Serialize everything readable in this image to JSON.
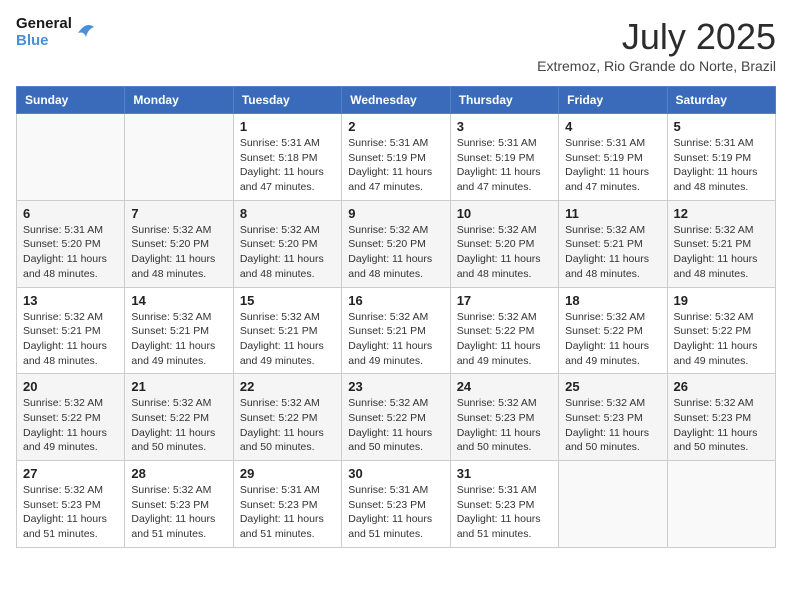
{
  "header": {
    "logo_line1": "General",
    "logo_line2": "Blue",
    "month": "July 2025",
    "location": "Extremoz, Rio Grande do Norte, Brazil"
  },
  "weekdays": [
    "Sunday",
    "Monday",
    "Tuesday",
    "Wednesday",
    "Thursday",
    "Friday",
    "Saturday"
  ],
  "weeks": [
    [
      {
        "day": "",
        "info": ""
      },
      {
        "day": "",
        "info": ""
      },
      {
        "day": "1",
        "info": "Sunrise: 5:31 AM\nSunset: 5:18 PM\nDaylight: 11 hours and 47 minutes."
      },
      {
        "day": "2",
        "info": "Sunrise: 5:31 AM\nSunset: 5:19 PM\nDaylight: 11 hours and 47 minutes."
      },
      {
        "day": "3",
        "info": "Sunrise: 5:31 AM\nSunset: 5:19 PM\nDaylight: 11 hours and 47 minutes."
      },
      {
        "day": "4",
        "info": "Sunrise: 5:31 AM\nSunset: 5:19 PM\nDaylight: 11 hours and 47 minutes."
      },
      {
        "day": "5",
        "info": "Sunrise: 5:31 AM\nSunset: 5:19 PM\nDaylight: 11 hours and 48 minutes."
      }
    ],
    [
      {
        "day": "6",
        "info": "Sunrise: 5:31 AM\nSunset: 5:20 PM\nDaylight: 11 hours and 48 minutes."
      },
      {
        "day": "7",
        "info": "Sunrise: 5:32 AM\nSunset: 5:20 PM\nDaylight: 11 hours and 48 minutes."
      },
      {
        "day": "8",
        "info": "Sunrise: 5:32 AM\nSunset: 5:20 PM\nDaylight: 11 hours and 48 minutes."
      },
      {
        "day": "9",
        "info": "Sunrise: 5:32 AM\nSunset: 5:20 PM\nDaylight: 11 hours and 48 minutes."
      },
      {
        "day": "10",
        "info": "Sunrise: 5:32 AM\nSunset: 5:20 PM\nDaylight: 11 hours and 48 minutes."
      },
      {
        "day": "11",
        "info": "Sunrise: 5:32 AM\nSunset: 5:21 PM\nDaylight: 11 hours and 48 minutes."
      },
      {
        "day": "12",
        "info": "Sunrise: 5:32 AM\nSunset: 5:21 PM\nDaylight: 11 hours and 48 minutes."
      }
    ],
    [
      {
        "day": "13",
        "info": "Sunrise: 5:32 AM\nSunset: 5:21 PM\nDaylight: 11 hours and 48 minutes."
      },
      {
        "day": "14",
        "info": "Sunrise: 5:32 AM\nSunset: 5:21 PM\nDaylight: 11 hours and 49 minutes."
      },
      {
        "day": "15",
        "info": "Sunrise: 5:32 AM\nSunset: 5:21 PM\nDaylight: 11 hours and 49 minutes."
      },
      {
        "day": "16",
        "info": "Sunrise: 5:32 AM\nSunset: 5:21 PM\nDaylight: 11 hours and 49 minutes."
      },
      {
        "day": "17",
        "info": "Sunrise: 5:32 AM\nSunset: 5:22 PM\nDaylight: 11 hours and 49 minutes."
      },
      {
        "day": "18",
        "info": "Sunrise: 5:32 AM\nSunset: 5:22 PM\nDaylight: 11 hours and 49 minutes."
      },
      {
        "day": "19",
        "info": "Sunrise: 5:32 AM\nSunset: 5:22 PM\nDaylight: 11 hours and 49 minutes."
      }
    ],
    [
      {
        "day": "20",
        "info": "Sunrise: 5:32 AM\nSunset: 5:22 PM\nDaylight: 11 hours and 49 minutes."
      },
      {
        "day": "21",
        "info": "Sunrise: 5:32 AM\nSunset: 5:22 PM\nDaylight: 11 hours and 50 minutes."
      },
      {
        "day": "22",
        "info": "Sunrise: 5:32 AM\nSunset: 5:22 PM\nDaylight: 11 hours and 50 minutes."
      },
      {
        "day": "23",
        "info": "Sunrise: 5:32 AM\nSunset: 5:22 PM\nDaylight: 11 hours and 50 minutes."
      },
      {
        "day": "24",
        "info": "Sunrise: 5:32 AM\nSunset: 5:23 PM\nDaylight: 11 hours and 50 minutes."
      },
      {
        "day": "25",
        "info": "Sunrise: 5:32 AM\nSunset: 5:23 PM\nDaylight: 11 hours and 50 minutes."
      },
      {
        "day": "26",
        "info": "Sunrise: 5:32 AM\nSunset: 5:23 PM\nDaylight: 11 hours and 50 minutes."
      }
    ],
    [
      {
        "day": "27",
        "info": "Sunrise: 5:32 AM\nSunset: 5:23 PM\nDaylight: 11 hours and 51 minutes."
      },
      {
        "day": "28",
        "info": "Sunrise: 5:32 AM\nSunset: 5:23 PM\nDaylight: 11 hours and 51 minutes."
      },
      {
        "day": "29",
        "info": "Sunrise: 5:31 AM\nSunset: 5:23 PM\nDaylight: 11 hours and 51 minutes."
      },
      {
        "day": "30",
        "info": "Sunrise: 5:31 AM\nSunset: 5:23 PM\nDaylight: 11 hours and 51 minutes."
      },
      {
        "day": "31",
        "info": "Sunrise: 5:31 AM\nSunset: 5:23 PM\nDaylight: 11 hours and 51 minutes."
      },
      {
        "day": "",
        "info": ""
      },
      {
        "day": "",
        "info": ""
      }
    ]
  ]
}
